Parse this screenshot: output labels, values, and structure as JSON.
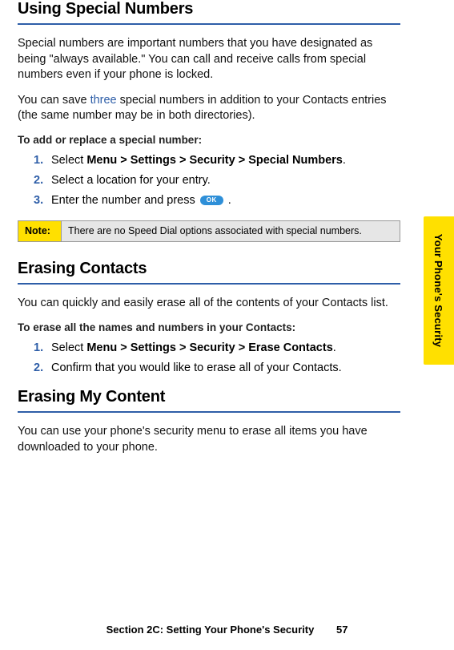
{
  "side_tab": "Your Phone's Security",
  "sections": {
    "s1": {
      "title": "Using Special Numbers",
      "p1": "Special numbers are important numbers that you have designated as being \"always available.\" You can call and receive calls from special numbers even if your phone is locked.",
      "p2a": "You can save ",
      "p2_three": "three",
      "p2b": " special numbers in addition to your Contacts entries (the same number may be in both directories).",
      "sub": "To add or replace a special number:",
      "steps": {
        "n1": "1.",
        "t1a": "Select ",
        "t1_path": "Menu > Settings > Security > Special Numbers",
        "t1b": ".",
        "n2": "2.",
        "t2": "Select a location for your entry.",
        "n3": "3.",
        "t3a": "Enter the number and press ",
        "ok": "OK",
        "t3b": " ."
      },
      "note_label": "Note:",
      "note_text": "There are no Speed Dial options associated with special numbers."
    },
    "s2": {
      "title": "Erasing Contacts",
      "p1": "You can quickly and easily erase all of the contents of your Contacts list.",
      "sub": "To erase all the names and numbers in your Contacts:",
      "steps": {
        "n1": "1.",
        "t1a": "Select ",
        "t1_path": "Menu > Settings > Security > Erase Contacts",
        "t1b": ".",
        "n2": "2.",
        "t2": "Confirm that you would like to erase all of your Contacts."
      }
    },
    "s3": {
      "title": "Erasing My Content",
      "p1": "You can use your phone's security menu to erase all items you have downloaded to your phone."
    }
  },
  "footer": {
    "section": "Section 2C: Setting Your Phone's Security",
    "page": "57"
  }
}
